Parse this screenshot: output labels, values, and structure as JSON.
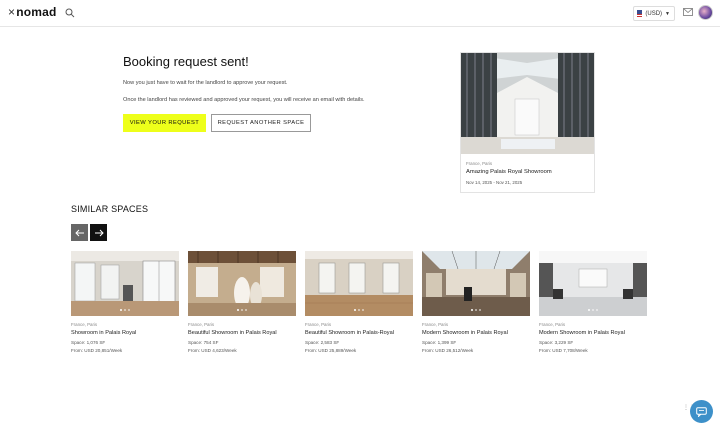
{
  "header": {
    "logo_text": "nomad",
    "logo_x": "×",
    "currency": "(USD)",
    "icons": [
      "search-icon",
      "us-flag-icon",
      "chevron-down-icon",
      "mail-icon",
      "avatar"
    ]
  },
  "confirmation": {
    "title": "Booking request sent!",
    "line1": "Now you just have to wait for the landlord to approve your request.",
    "line2": "Once the landlord has reviewed and approved your request, you will receive an email with details.",
    "primary_button": "VIEW YOUR REQUEST",
    "secondary_button": "REQUEST ANOTHER SPACE"
  },
  "booking": {
    "location": "France, Paris",
    "name": "Amazing Palais Royal Showroom",
    "dates": "Nov 14, 2025 - Nov 21, 2025"
  },
  "similar": {
    "title": "SIMILAR SPACES",
    "prev_icon": "arrow-left-icon",
    "next_icon": "arrow-right-icon",
    "items": [
      {
        "location": "France, Paris",
        "name": "Showroom in Palais Royal",
        "space": "Space: 1,076 SF",
        "price": "From: USD 20,851/Week"
      },
      {
        "location": "France, Paris",
        "name": "Beautiful Showroom in Palais Royal",
        "space": "Space: 754 SF",
        "price": "From: USD 4,623/Week"
      },
      {
        "location": "France, Paris",
        "name": "Beautiful Showroom in Palais-Royal",
        "space": "Space: 2,583 SF",
        "price": "From: USD 25,889/Week"
      },
      {
        "location": "France, Paris",
        "name": "Modern Showroom in Palais Royal",
        "space": "Space: 1,399 SF",
        "price": "From: USD 26,512/Week"
      },
      {
        "location": "France, Paris",
        "name": "Modern Showroom in Palais Royal",
        "space": "Space: 3,229 SF",
        "price": "From: USD 7,708/Week"
      }
    ]
  },
  "colors": {
    "accent_yellow": "#eeff1a",
    "chat_blue": "#3d90c9"
  }
}
